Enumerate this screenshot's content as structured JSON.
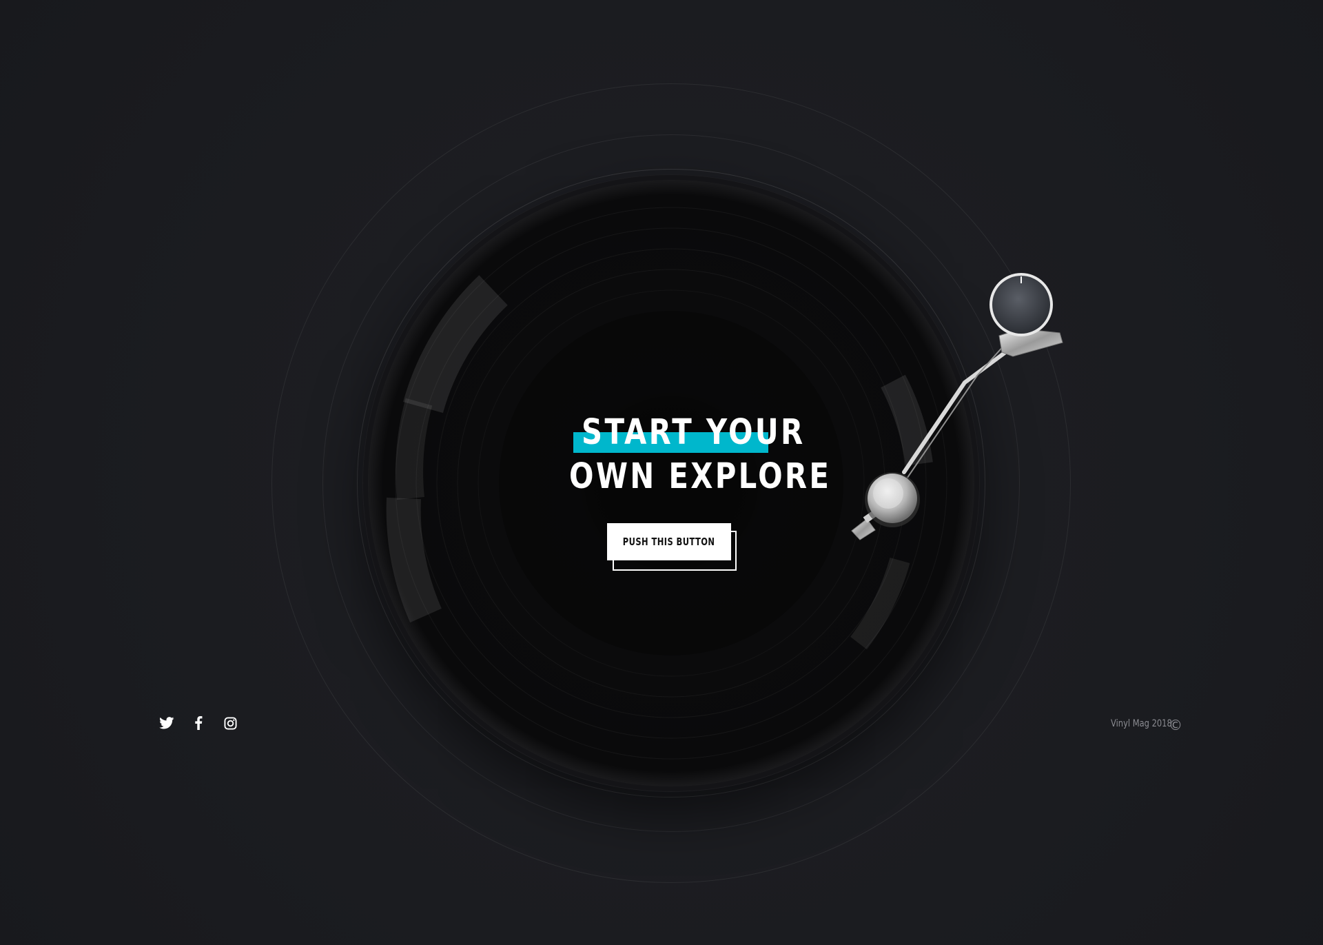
{
  "hero": {
    "headline_line1": "START YOUR",
    "headline_line2": "OWN EXPLORE",
    "cta_label": "PUSH THIS BUTTON"
  },
  "footer": {
    "copyright": "Vinyl Mag 2018",
    "copyright_symbol": "©",
    "social": [
      {
        "name": "twitter",
        "icon": "twitter-icon"
      },
      {
        "name": "facebook",
        "icon": "facebook-icon"
      },
      {
        "name": "instagram",
        "icon": "instagram-icon"
      }
    ]
  },
  "colors": {
    "background": "#1b1c20",
    "accent": "#00b7cc",
    "text": "#ffffff",
    "muted": "#8b8c92"
  }
}
